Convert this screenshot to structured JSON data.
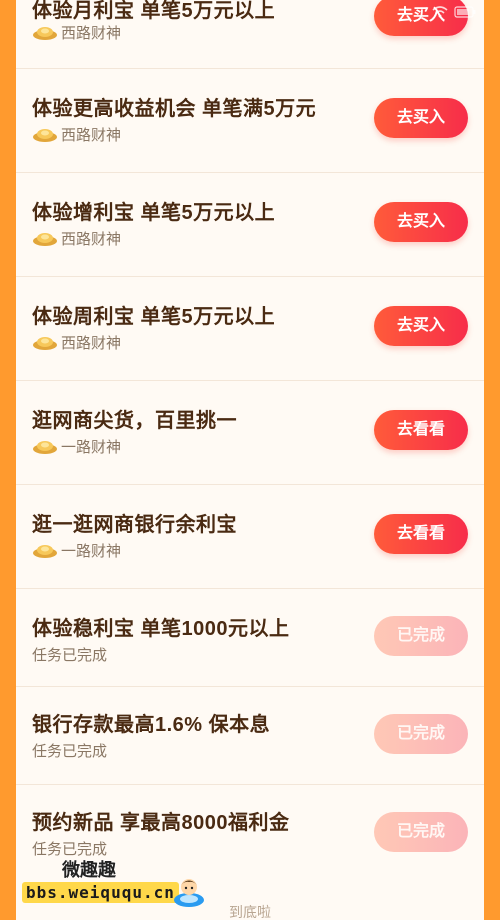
{
  "tasks": [
    {
      "title": "体验月利宝 单笔5万元以上",
      "sub": "西路财神",
      "button": "去买入",
      "done": false
    },
    {
      "title": "体验更高收益机会 单笔满5万元",
      "sub": "西路财神",
      "button": "去买入",
      "done": false
    },
    {
      "title": "体验增利宝 单笔5万元以上",
      "sub": "西路财神",
      "button": "去买入",
      "done": false
    },
    {
      "title": "体验周利宝 单笔5万元以上",
      "sub": "西路财神",
      "button": "去买入",
      "done": false
    },
    {
      "title": "逛网商尖货，百里挑一",
      "sub": "一路财神",
      "button": "去看看",
      "done": false
    },
    {
      "title": "逛一逛网商银行余利宝",
      "sub": "一路财神",
      "button": "去看看",
      "done": false
    },
    {
      "title": "体验稳利宝 单笔1000元以上",
      "sub": "任务已完成",
      "button": "已完成",
      "done": true
    },
    {
      "title": "银行存款最高1.6% 保本息",
      "sub": "任务已完成",
      "button": "已完成",
      "done": true
    },
    {
      "title": "预约新品 享最高8000福利金",
      "sub": "任务已完成",
      "button": "已完成",
      "done": true
    }
  ],
  "footer": "到底啦",
  "watermark": {
    "name": "微趣趣",
    "url": "bbs.weiququ.cn"
  },
  "icons": {
    "coin": "gold-ingot-icon",
    "wifi": "wifi-icon",
    "battery": "battery-icon"
  },
  "colors": {
    "accent": "#f72d4a",
    "background": "#ff9a2e",
    "done": "#fbb4b8"
  }
}
